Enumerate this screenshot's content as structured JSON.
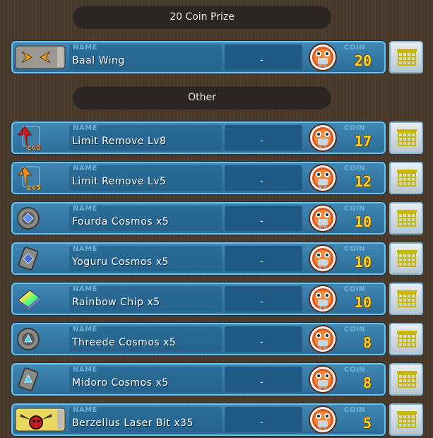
{
  "sections": [
    {
      "title": "20 Coin Prize"
    },
    {
      "title": "Other"
    }
  ],
  "labels": {
    "name_tag": "NAME",
    "coin_tag": "COIN",
    "placeholder": "-"
  },
  "items": [
    {
      "name": "Baal Wing",
      "coin": "20",
      "icon": "wing-icon"
    },
    {
      "name": "Limit Remove Lv8",
      "coin": "17",
      "icon": "limit-remove-lv8-icon",
      "badge": "Lv8"
    },
    {
      "name": "Limit Remove Lv5",
      "coin": "12",
      "icon": "limit-remove-lv5-icon",
      "badge": "Lv5"
    },
    {
      "name": "Fourda Cosmos x5",
      "coin": "10",
      "icon": "cosmos-round-icon"
    },
    {
      "name": "Yoguru Cosmos x5",
      "coin": "10",
      "icon": "cosmos-card-icon"
    },
    {
      "name": "Rainbow Chip x5",
      "coin": "10",
      "icon": "rainbow-chip-icon"
    },
    {
      "name": "Threede Cosmos x5",
      "coin": "8",
      "icon": "cosmos-round-icon"
    },
    {
      "name": "Midoro Cosmos x5",
      "coin": "8",
      "icon": "cosmos-card-icon"
    },
    {
      "name": "Berzelius Laser Bit x35",
      "coin": "5",
      "icon": "laser-bit-icon"
    }
  ]
}
